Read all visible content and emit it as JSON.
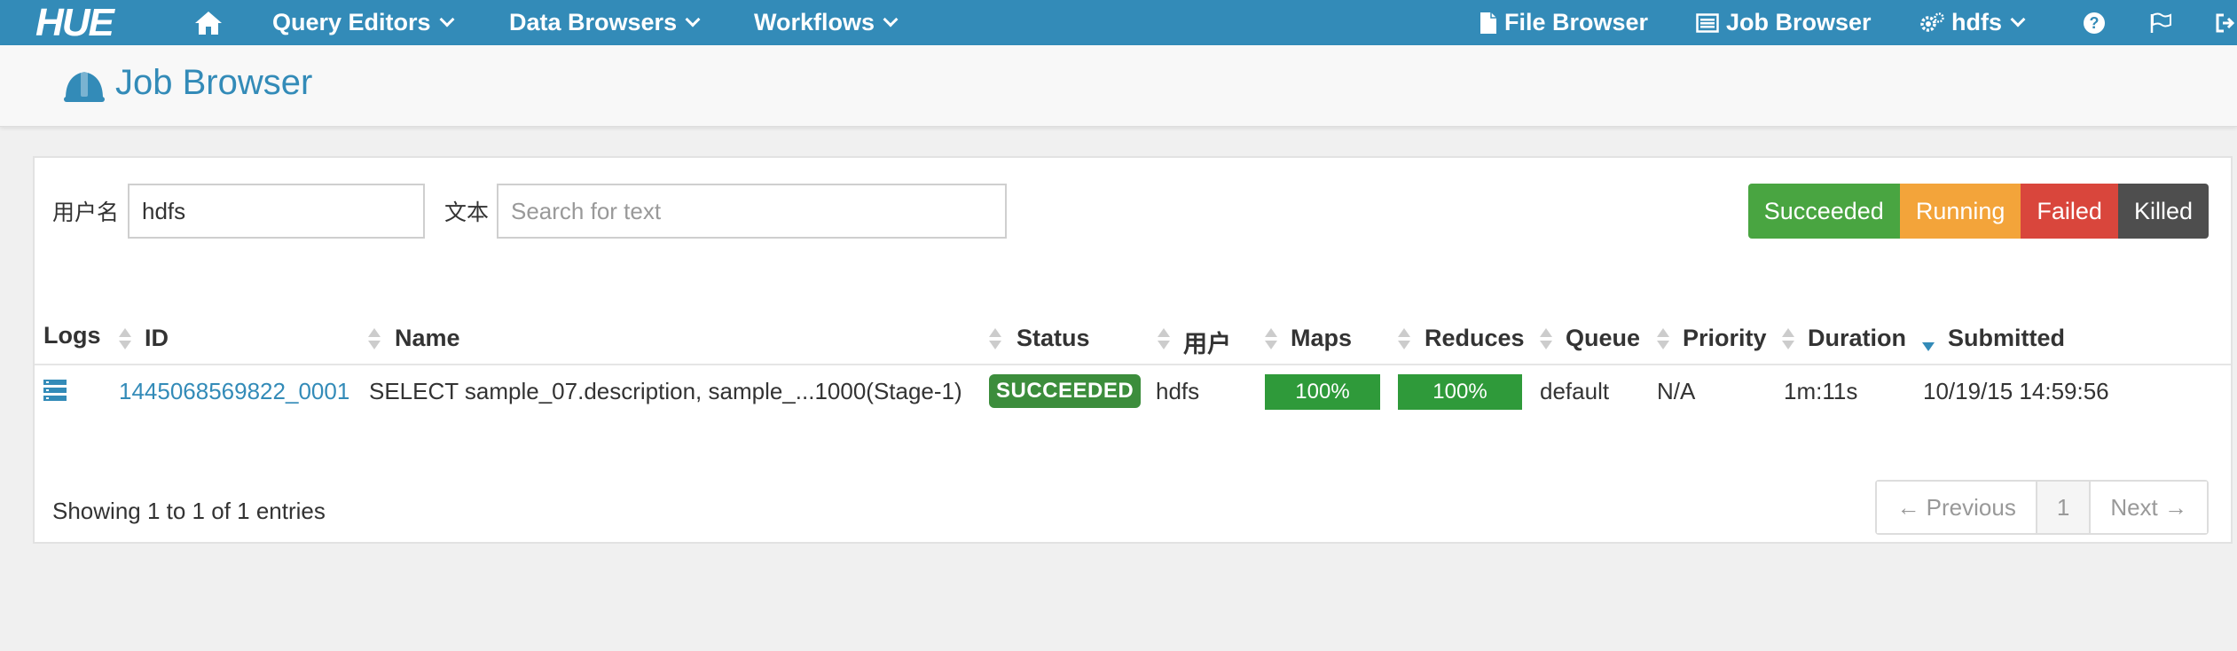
{
  "nav": {
    "logo": "HUE",
    "query_editors": "Query Editors",
    "data_browsers": "Data Browsers",
    "workflows": "Workflows",
    "file_browser": "File Browser",
    "job_browser": "Job Browser",
    "user": "hdfs"
  },
  "page": {
    "title": "Job Browser"
  },
  "filters": {
    "username_label": "用户名",
    "username_value": "hdfs",
    "text_label": "文本",
    "text_placeholder": "Search for text",
    "succeeded": "Succeeded",
    "running": "Running",
    "failed": "Failed",
    "killed": "Killed"
  },
  "table": {
    "headers": {
      "logs": "Logs",
      "id": "ID",
      "name": "Name",
      "status": "Status",
      "user": "用户",
      "maps": "Maps",
      "reduces": "Reduces",
      "queue": "Queue",
      "priority": "Priority",
      "duration": "Duration",
      "submitted": "Submitted"
    },
    "rows": [
      {
        "id": "1445068569822_0001",
        "name": "SELECT sample_07.description, sample_...1000(Stage-1)",
        "status": "SUCCEEDED",
        "user": "hdfs",
        "maps": "100%",
        "reduces": "100%",
        "queue": "default",
        "priority": "N/A",
        "duration": "1m:11s",
        "submitted": "10/19/15 14:59:56"
      }
    ]
  },
  "footer": {
    "showing": "Showing 1 to 1 of 1 entries"
  },
  "pagination": {
    "previous": "← Previous",
    "page": "1",
    "next": "Next →"
  },
  "colors": {
    "navbar": "#338bb8",
    "succeeded": "#49a541",
    "running": "#f3a43a",
    "failed": "#d9463c",
    "killed": "#4e4e4e",
    "progress": "#2f9a3a"
  }
}
